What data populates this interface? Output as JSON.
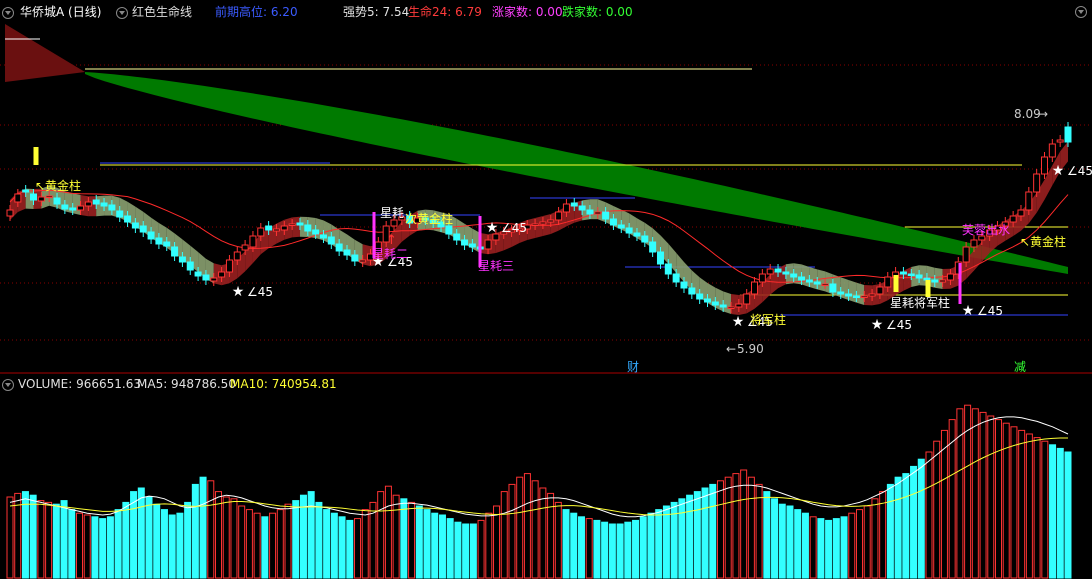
{
  "header": {
    "stock": "华侨城A (日线)",
    "indicator": "红色生命线",
    "items": [
      {
        "label": "前期高位: ",
        "value": "6.20",
        "color": "#3b5bff"
      },
      {
        "label": "强势5: ",
        "value": "7.54",
        "color": "#e0e0e0"
      },
      {
        "label": "生命24: ",
        "value": "6.79",
        "color": "#ff3b3b"
      },
      {
        "label": "涨家数: ",
        "value": "0.00",
        "color": "#ff40ff"
      },
      {
        "label": "跌家数: ",
        "value": "0.00",
        "color": "#33ff33"
      }
    ]
  },
  "volume_header": {
    "items": [
      {
        "label": "VOLUME: ",
        "value": "966651.63",
        "color": "#e0e0e0"
      },
      {
        "label": "MA5: ",
        "value": "948786.50",
        "color": "#e0e0e0"
      },
      {
        "label": "MA10: ",
        "value": "740954.81",
        "color": "#ffff33"
      }
    ]
  },
  "annotations": {
    "gold_left": "↖黄金柱",
    "gold_right": "↖黄金柱",
    "gold_mid": "次黄金柱",
    "star_labels": [
      "∠45",
      "∠45",
      "∠45",
      "∠45",
      "∠45",
      "∠45",
      "∠45"
    ],
    "xingshu1": "星耗",
    "xingshu2": "星耗三",
    "xingshu3": "星耗二",
    "anchor_mid": "黄金柱",
    "anchor2": "将军柱",
    "anchor3": "星耗二",
    "furong": "芙蓉出水",
    "biao": "星耗将军柱",
    "high_price": "8.09",
    "low_price": "5.90",
    "marker_cai": "财",
    "marker_jian": "减"
  },
  "colors": {
    "up": "#ff3333",
    "down": "#33ffff",
    "green_band": "#007a00",
    "red_band": "#9a2020",
    "grey_band": "#8aa070",
    "ma": "#ff2a2a",
    "yellow": "#ffff33",
    "blue": "#3344ff",
    "white": "#ffffff",
    "magenta": "#ff33ff",
    "grid": "#8a0000"
  },
  "chart_data": {
    "type": "candlestick",
    "ylim": [
      5.6,
      8.6
    ],
    "close": [
      6.92,
      7.08,
      7.1,
      7.02,
      7.05,
      7.06,
      6.98,
      6.93,
      6.92,
      6.96,
      7.0,
      6.98,
      6.96,
      6.92,
      6.85,
      6.8,
      6.74,
      6.7,
      6.63,
      6.58,
      6.56,
      6.46,
      6.4,
      6.32,
      6.26,
      6.22,
      6.24,
      6.3,
      6.42,
      6.5,
      6.57,
      6.66,
      6.74,
      6.72,
      6.73,
      6.76,
      6.78,
      6.77,
      6.71,
      6.68,
      6.64,
      6.58,
      6.51,
      6.47,
      6.41,
      6.42,
      6.48,
      6.6,
      6.76,
      6.82,
      6.85,
      6.79,
      6.84,
      6.82,
      6.79,
      6.75,
      6.68,
      6.62,
      6.57,
      6.55,
      6.53,
      6.62,
      6.68,
      6.7,
      6.72,
      6.73,
      6.77,
      6.78,
      6.8,
      6.82,
      6.9,
      6.98,
      6.96,
      6.92,
      6.88,
      6.9,
      6.83,
      6.77,
      6.74,
      6.69,
      6.66,
      6.6,
      6.5,
      6.38,
      6.28,
      6.2,
      6.14,
      6.08,
      6.03,
      6.0,
      5.97,
      5.95,
      5.95,
      5.98,
      6.08,
      6.2,
      6.28,
      6.33,
      6.3,
      6.28,
      6.25,
      6.22,
      6.2,
      6.18,
      6.18,
      6.1,
      6.08,
      6.06,
      6.05,
      6.06,
      6.08,
      6.15,
      6.25,
      6.3,
      6.28,
      6.27,
      6.24,
      6.22,
      6.2,
      6.22,
      6.28,
      6.4,
      6.55,
      6.62,
      6.66,
      6.72,
      6.76,
      6.8,
      6.86,
      6.92,
      7.1,
      7.28,
      7.45,
      7.58,
      7.62,
      7.6
    ],
    "open": [
      6.86,
      7.0,
      7.12,
      7.08,
      7.01,
      7.05,
      7.04,
      6.97,
      6.94,
      6.92,
      6.96,
      7.02,
      6.99,
      6.97,
      6.91,
      6.86,
      6.79,
      6.76,
      6.7,
      6.64,
      6.6,
      6.55,
      6.45,
      6.4,
      6.3,
      6.27,
      6.21,
      6.25,
      6.3,
      6.42,
      6.52,
      6.55,
      6.66,
      6.76,
      6.71,
      6.72,
      6.77,
      6.79,
      6.77,
      6.72,
      6.67,
      6.65,
      6.58,
      6.52,
      6.47,
      6.4,
      6.42,
      6.48,
      6.6,
      6.76,
      6.82,
      6.86,
      6.79,
      6.84,
      6.82,
      6.8,
      6.76,
      6.68,
      6.62,
      6.58,
      6.55,
      6.53,
      6.62,
      6.68,
      6.7,
      6.72,
      6.73,
      6.77,
      6.78,
      6.8,
      6.82,
      6.9,
      6.99,
      6.96,
      6.92,
      6.88,
      6.9,
      6.83,
      6.77,
      6.74,
      6.69,
      6.66,
      6.6,
      6.5,
      6.38,
      6.28,
      6.2,
      6.14,
      6.08,
      6.03,
      6.0,
      5.97,
      5.94,
      5.95,
      5.98,
      6.08,
      6.2,
      6.28,
      6.33,
      6.3,
      6.28,
      6.25,
      6.22,
      6.2,
      6.18,
      6.18,
      6.1,
      6.08,
      6.06,
      6.05,
      6.06,
      6.08,
      6.15,
      6.25,
      6.3,
      6.28,
      6.27,
      6.24,
      6.22,
      6.2,
      6.22,
      6.28,
      6.4,
      6.55,
      6.62,
      6.66,
      6.72,
      6.76,
      6.8,
      6.86,
      6.92,
      7.1,
      7.28,
      7.45,
      7.6,
      7.75
    ],
    "volume": [
      450,
      470,
      480,
      460,
      430,
      420,
      410,
      430,
      380,
      360,
      350,
      340,
      330,
      340,
      380,
      420,
      480,
      500,
      450,
      410,
      380,
      350,
      360,
      420,
      520,
      560,
      540,
      480,
      450,
      440,
      400,
      380,
      360,
      340,
      360,
      380,
      410,
      430,
      460,
      480,
      420,
      380,
      360,
      340,
      320,
      330,
      380,
      420,
      480,
      510,
      460,
      440,
      420,
      400,
      380,
      360,
      350,
      330,
      310,
      300,
      300,
      320,
      360,
      400,
      480,
      520,
      560,
      580,
      540,
      500,
      470,
      420,
      380,
      360,
      340,
      330,
      320,
      310,
      300,
      300,
      310,
      320,
      340,
      360,
      380,
      400,
      420,
      440,
      460,
      480,
      500,
      520,
      540,
      560,
      580,
      600,
      560,
      520,
      480,
      440,
      410,
      400,
      380,
      360,
      340,
      330,
      320,
      330,
      340,
      360,
      380,
      400,
      440,
      480,
      520,
      560,
      580,
      620,
      660,
      700,
      760,
      820,
      880,
      940,
      960,
      940,
      920,
      900,
      880,
      860,
      840,
      820,
      800,
      780,
      760,
      740,
      720,
      700
    ],
    "ma_vol5": [
      420,
      430,
      440,
      430,
      420,
      410,
      400,
      390,
      380,
      370,
      360,
      355,
      350,
      355,
      370,
      395,
      420,
      445,
      455,
      450,
      440,
      420,
      400,
      390,
      395,
      410,
      430,
      450,
      460,
      455,
      445,
      430,
      415,
      400,
      390,
      385,
      385,
      390,
      395,
      400,
      395,
      390,
      380,
      370,
      360,
      355,
      350,
      360,
      380,
      400,
      410,
      415,
      415,
      410,
      405,
      395,
      385,
      375,
      365,
      355,
      350,
      345,
      345,
      350,
      360,
      375,
      395,
      415,
      430,
      440,
      445,
      445,
      440,
      430,
      415,
      400,
      385,
      370,
      355,
      345,
      340,
      340,
      345,
      355,
      365,
      380,
      395,
      410,
      425,
      440,
      455,
      470,
      485,
      500,
      510,
      515,
      515,
      510,
      500,
      485,
      470,
      455,
      440,
      425,
      410,
      400,
      395,
      395,
      400,
      410,
      420,
      435,
      455,
      475,
      500,
      525,
      555,
      585,
      615,
      650,
      685,
      720,
      755,
      790,
      820,
      845,
      865,
      880,
      890,
      895,
      895,
      890,
      880,
      870,
      855,
      840,
      820,
      800
    ],
    "ma_vol10": [
      400,
      405,
      410,
      410,
      410,
      405,
      400,
      395,
      390,
      385,
      380,
      375,
      370,
      370,
      372,
      378,
      385,
      395,
      405,
      410,
      412,
      410,
      405,
      400,
      398,
      400,
      405,
      412,
      420,
      425,
      425,
      422,
      418,
      412,
      406,
      400,
      397,
      395,
      394,
      395,
      395,
      394,
      392,
      388,
      383,
      378,
      374,
      372,
      372,
      374,
      378,
      382,
      386,
      388,
      388,
      386,
      382,
      377,
      371,
      366,
      361,
      357,
      354,
      353,
      354,
      358,
      364,
      372,
      380,
      388,
      395,
      400,
      402,
      402,
      399,
      394,
      388,
      381,
      374,
      367,
      361,
      356,
      352,
      350,
      350,
      352,
      356,
      362,
      370,
      378,
      388,
      398,
      408,
      418,
      428,
      436,
      442,
      446,
      448,
      448,
      446,
      442,
      436,
      429,
      421,
      414,
      407,
      402,
      399,
      398,
      399,
      402,
      407,
      415,
      425,
      437,
      451,
      467,
      485,
      505,
      527,
      550,
      574,
      598,
      622,
      646,
      668,
      688,
      706,
      722,
      736,
      748,
      758,
      766,
      772,
      776,
      778,
      778
    ]
  }
}
